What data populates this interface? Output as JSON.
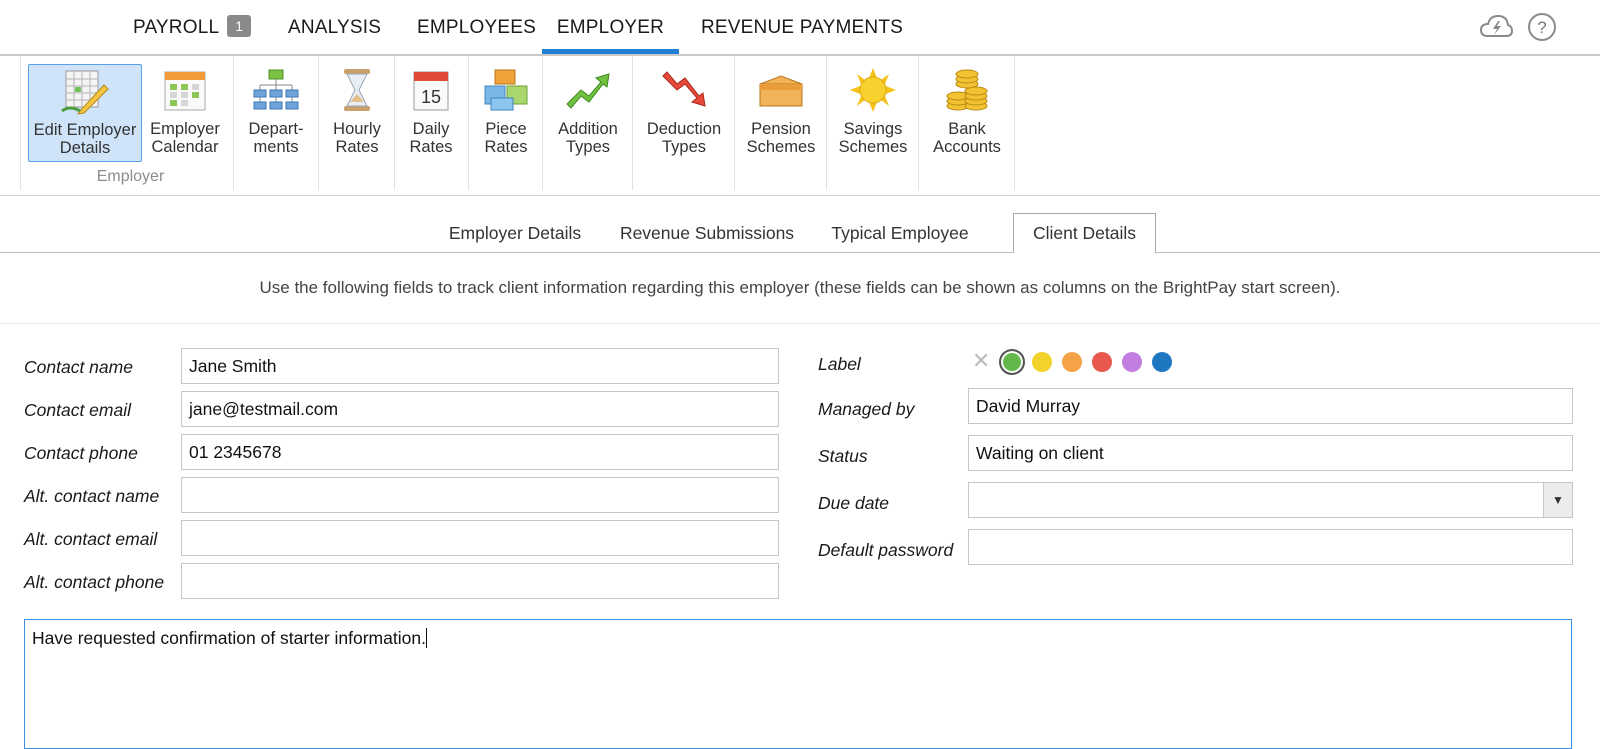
{
  "nav": {
    "tabs": [
      {
        "label": "PAYROLL",
        "badge": "1"
      },
      {
        "label": "ANALYSIS"
      },
      {
        "label": "EMPLOYEES"
      },
      {
        "label": "EMPLOYER"
      },
      {
        "label": "REVENUE PAYMENTS"
      }
    ],
    "active_tab": "EMPLOYER",
    "icons": [
      "cloud-sync-icon",
      "help-icon"
    ]
  },
  "ribbon": {
    "group_label": "Employer",
    "buttons": [
      {
        "label_line1": "Edit Employer",
        "label_line2": "Details",
        "icon": "edit-employer-icon",
        "active": true
      },
      {
        "label_line1": "Employer",
        "label_line2": "Calendar",
        "icon": "calendar-icon"
      },
      {
        "label_line1": "Depart-",
        "label_line2": "ments",
        "icon": "org-chart-icon"
      },
      {
        "label_line1": "Hourly",
        "label_line2": "Rates",
        "icon": "hourglass-icon"
      },
      {
        "label_line1": "Daily",
        "label_line2": "Rates",
        "icon": "day-calendar-icon",
        "day_number": "15"
      },
      {
        "label_line1": "Piece",
        "label_line2": "Rates",
        "icon": "blocks-icon"
      },
      {
        "label_line1": "Addition",
        "label_line2": "Types",
        "icon": "arrow-up-icon"
      },
      {
        "label_line1": "Deduction",
        "label_line2": "Types",
        "icon": "arrow-down-icon"
      },
      {
        "label_line1": "Pension",
        "label_line2": "Schemes",
        "icon": "box-icon"
      },
      {
        "label_line1": "Savings",
        "label_line2": "Schemes",
        "icon": "sun-icon"
      },
      {
        "label_line1": "Bank",
        "label_line2": "Accounts",
        "icon": "coins-icon"
      }
    ]
  },
  "subtabs": {
    "items": [
      "Employer Details",
      "Revenue Submissions",
      "Typical Employee",
      "Client Details"
    ],
    "active": "Client Details"
  },
  "info_text": "Use the following fields to track client information regarding this employer (these fields can be shown as columns on the BrightPay start screen).",
  "form": {
    "left": [
      {
        "label": "Contact name",
        "value": "Jane Smith"
      },
      {
        "label": "Contact email",
        "value": "jane@testmail.com"
      },
      {
        "label": "Contact phone",
        "value": "01 2345678"
      },
      {
        "label": "Alt. contact name",
        "value": ""
      },
      {
        "label": "Alt. contact email",
        "value": ""
      },
      {
        "label": "Alt. contact phone",
        "value": ""
      }
    ],
    "label_field": {
      "label": "Label",
      "clear_glyph": "✕",
      "colors": [
        "#62b84a",
        "#f2d32b",
        "#f5a347",
        "#e8584c",
        "#c27ee0",
        "#1f77c2"
      ],
      "selected_color": "#62b84a"
    },
    "right": [
      {
        "label": "Managed by",
        "value": "David Murray"
      },
      {
        "label": "Status",
        "value": "Waiting on client"
      },
      {
        "label": "Due date",
        "value": ""
      },
      {
        "label": "Default password",
        "value": ""
      }
    ],
    "dropdown_arrow": "▼",
    "notes": "Have requested confirmation of starter information."
  },
  "colors": {
    "accent": "#1f7fd1",
    "active_button_bg": "#cfe4f9"
  }
}
